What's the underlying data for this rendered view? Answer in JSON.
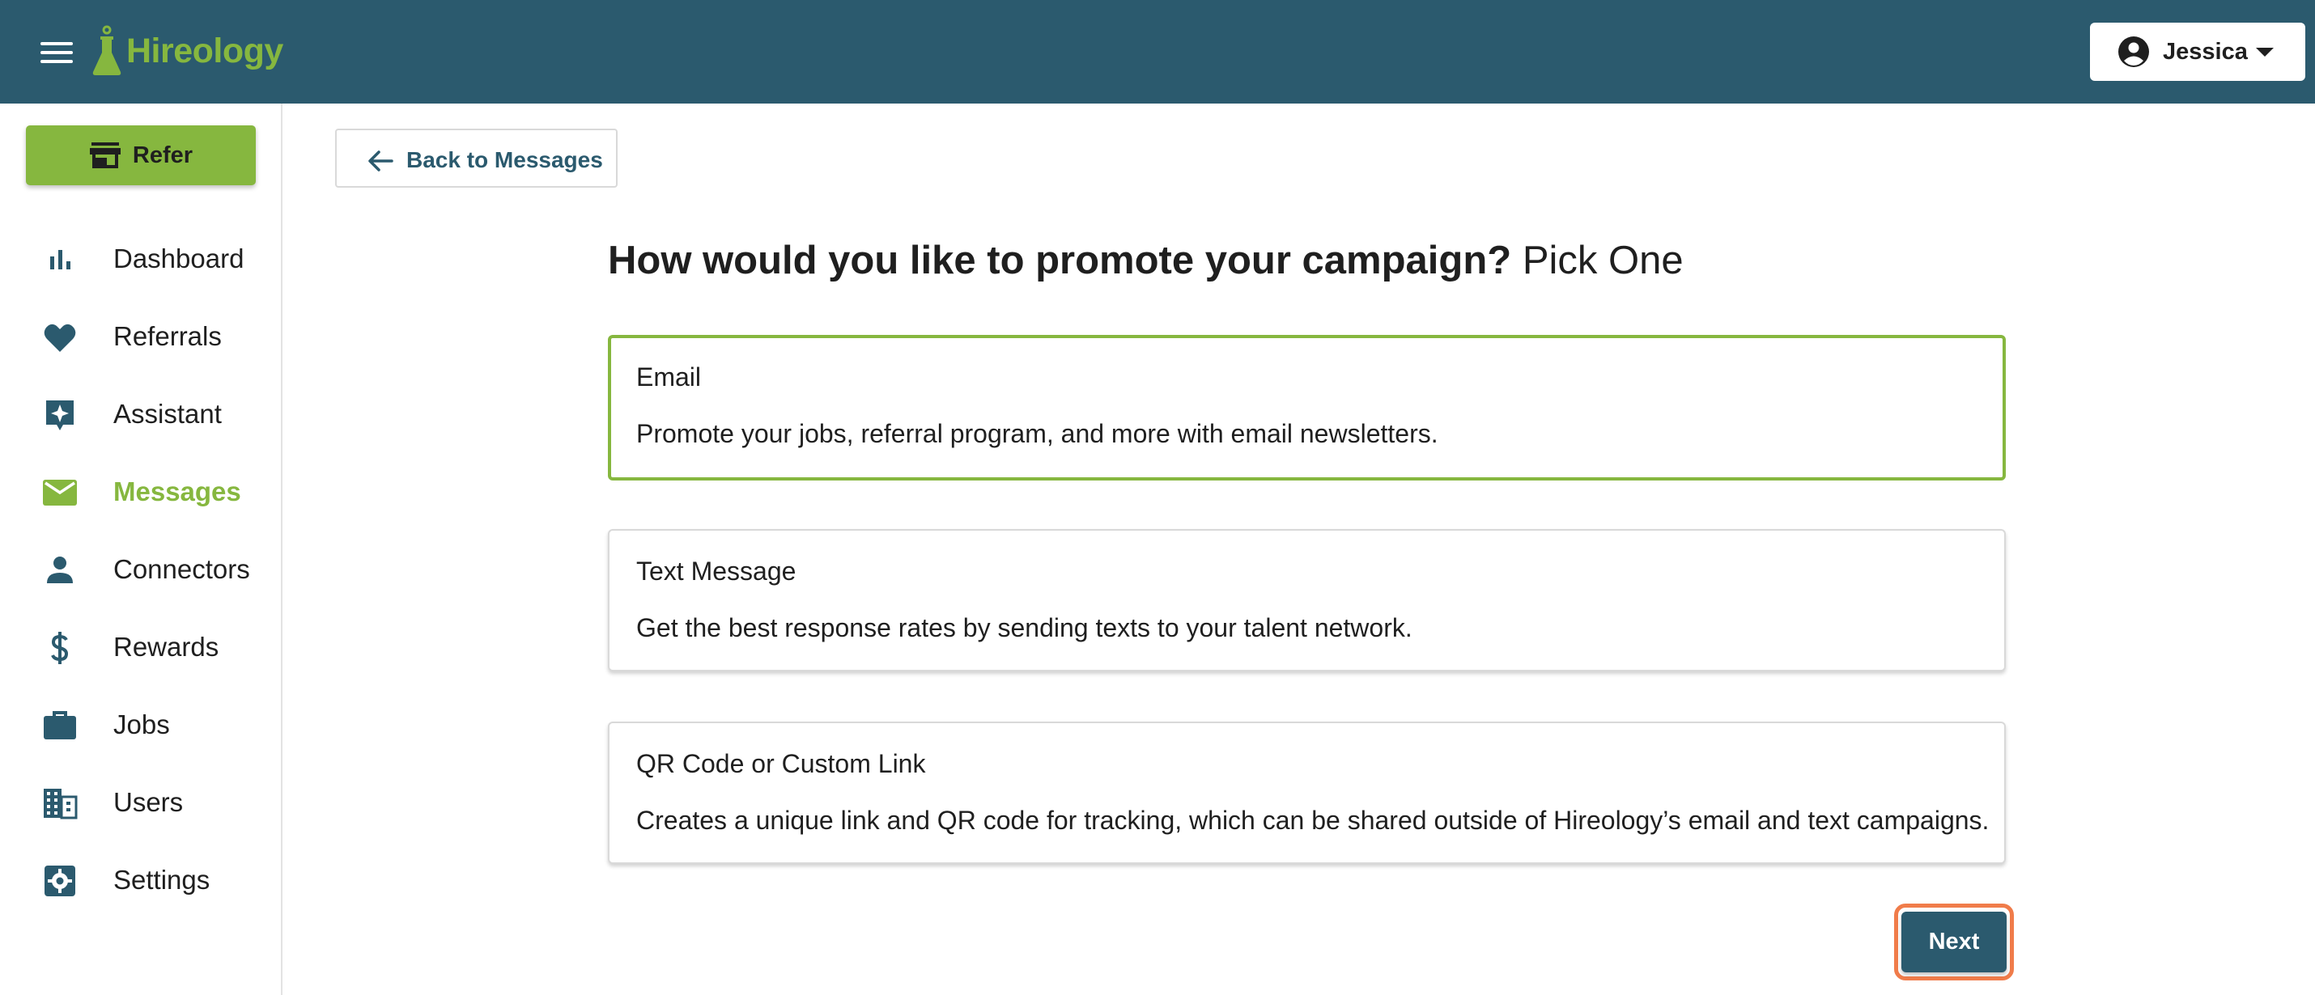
{
  "app": {
    "brand": "Hireology",
    "colors": {
      "header": "#2b5a6e",
      "accent": "#86b73f",
      "focus": "#f07c4a"
    }
  },
  "header": {
    "menu_icon": "hamburger-menu-icon",
    "user_name": "Jessica",
    "user_icon": "account-circle-icon",
    "caret_icon": "caret-down-icon"
  },
  "sidebar": {
    "refer": {
      "label": "Refer",
      "icon": "storefront-icon"
    },
    "items": [
      {
        "label": "Dashboard",
        "icon": "bar-chart-icon",
        "active": false
      },
      {
        "label": "Referrals",
        "icon": "heart-icon",
        "active": false
      },
      {
        "label": "Assistant",
        "icon": "sparkle-icon",
        "active": false
      },
      {
        "label": "Messages",
        "icon": "mail-icon",
        "active": true
      },
      {
        "label": "Connectors",
        "icon": "person-icon",
        "active": false
      },
      {
        "label": "Rewards",
        "icon": "dollar-icon",
        "active": false
      },
      {
        "label": "Jobs",
        "icon": "briefcase-icon",
        "active": false
      },
      {
        "label": "Users",
        "icon": "building-icon",
        "active": false
      },
      {
        "label": "Settings",
        "icon": "gear-icon",
        "active": false
      }
    ]
  },
  "main": {
    "back_label": "Back to Messages",
    "title_strong": "How would you like to promote your campaign?",
    "title_light": "Pick One",
    "options": [
      {
        "title": "Email",
        "description": "Promote your jobs, referral program, and more with email newsletters.",
        "selected": true
      },
      {
        "title": "Text Message",
        "description": "Get the best response rates by sending texts to your talent network.",
        "selected": false
      },
      {
        "title": "QR Code or Custom Link",
        "description": "Creates a unique link and QR code for tracking, which can be shared outside of Hireology’s email and text campaigns.",
        "selected": false
      }
    ],
    "next_label": "Next"
  }
}
